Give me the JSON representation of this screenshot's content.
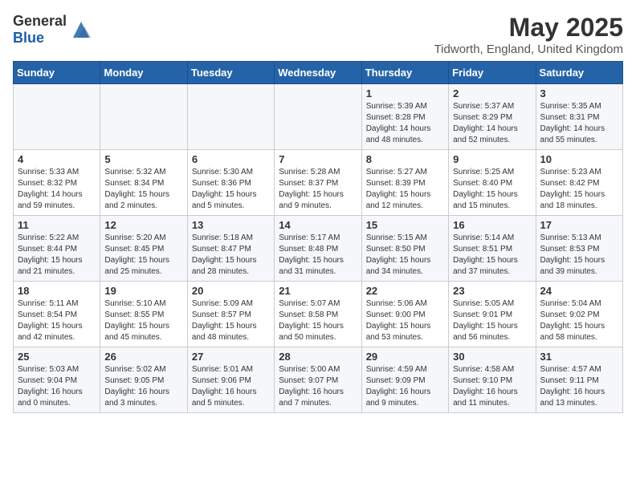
{
  "header": {
    "logo_general": "General",
    "logo_blue": "Blue",
    "month_year": "May 2025",
    "location": "Tidworth, England, United Kingdom"
  },
  "weekdays": [
    "Sunday",
    "Monday",
    "Tuesday",
    "Wednesday",
    "Thursday",
    "Friday",
    "Saturday"
  ],
  "weeks": [
    [
      {
        "day": "",
        "info": ""
      },
      {
        "day": "",
        "info": ""
      },
      {
        "day": "",
        "info": ""
      },
      {
        "day": "",
        "info": ""
      },
      {
        "day": "1",
        "info": "Sunrise: 5:39 AM\nSunset: 8:28 PM\nDaylight: 14 hours\nand 48 minutes."
      },
      {
        "day": "2",
        "info": "Sunrise: 5:37 AM\nSunset: 8:29 PM\nDaylight: 14 hours\nand 52 minutes."
      },
      {
        "day": "3",
        "info": "Sunrise: 5:35 AM\nSunset: 8:31 PM\nDaylight: 14 hours\nand 55 minutes."
      }
    ],
    [
      {
        "day": "4",
        "info": "Sunrise: 5:33 AM\nSunset: 8:32 PM\nDaylight: 14 hours\nand 59 minutes."
      },
      {
        "day": "5",
        "info": "Sunrise: 5:32 AM\nSunset: 8:34 PM\nDaylight: 15 hours\nand 2 minutes."
      },
      {
        "day": "6",
        "info": "Sunrise: 5:30 AM\nSunset: 8:36 PM\nDaylight: 15 hours\nand 5 minutes."
      },
      {
        "day": "7",
        "info": "Sunrise: 5:28 AM\nSunset: 8:37 PM\nDaylight: 15 hours\nand 9 minutes."
      },
      {
        "day": "8",
        "info": "Sunrise: 5:27 AM\nSunset: 8:39 PM\nDaylight: 15 hours\nand 12 minutes."
      },
      {
        "day": "9",
        "info": "Sunrise: 5:25 AM\nSunset: 8:40 PM\nDaylight: 15 hours\nand 15 minutes."
      },
      {
        "day": "10",
        "info": "Sunrise: 5:23 AM\nSunset: 8:42 PM\nDaylight: 15 hours\nand 18 minutes."
      }
    ],
    [
      {
        "day": "11",
        "info": "Sunrise: 5:22 AM\nSunset: 8:44 PM\nDaylight: 15 hours\nand 21 minutes."
      },
      {
        "day": "12",
        "info": "Sunrise: 5:20 AM\nSunset: 8:45 PM\nDaylight: 15 hours\nand 25 minutes."
      },
      {
        "day": "13",
        "info": "Sunrise: 5:18 AM\nSunset: 8:47 PM\nDaylight: 15 hours\nand 28 minutes."
      },
      {
        "day": "14",
        "info": "Sunrise: 5:17 AM\nSunset: 8:48 PM\nDaylight: 15 hours\nand 31 minutes."
      },
      {
        "day": "15",
        "info": "Sunrise: 5:15 AM\nSunset: 8:50 PM\nDaylight: 15 hours\nand 34 minutes."
      },
      {
        "day": "16",
        "info": "Sunrise: 5:14 AM\nSunset: 8:51 PM\nDaylight: 15 hours\nand 37 minutes."
      },
      {
        "day": "17",
        "info": "Sunrise: 5:13 AM\nSunset: 8:53 PM\nDaylight: 15 hours\nand 39 minutes."
      }
    ],
    [
      {
        "day": "18",
        "info": "Sunrise: 5:11 AM\nSunset: 8:54 PM\nDaylight: 15 hours\nand 42 minutes."
      },
      {
        "day": "19",
        "info": "Sunrise: 5:10 AM\nSunset: 8:55 PM\nDaylight: 15 hours\nand 45 minutes."
      },
      {
        "day": "20",
        "info": "Sunrise: 5:09 AM\nSunset: 8:57 PM\nDaylight: 15 hours\nand 48 minutes."
      },
      {
        "day": "21",
        "info": "Sunrise: 5:07 AM\nSunset: 8:58 PM\nDaylight: 15 hours\nand 50 minutes."
      },
      {
        "day": "22",
        "info": "Sunrise: 5:06 AM\nSunset: 9:00 PM\nDaylight: 15 hours\nand 53 minutes."
      },
      {
        "day": "23",
        "info": "Sunrise: 5:05 AM\nSunset: 9:01 PM\nDaylight: 15 hours\nand 56 minutes."
      },
      {
        "day": "24",
        "info": "Sunrise: 5:04 AM\nSunset: 9:02 PM\nDaylight: 15 hours\nand 58 minutes."
      }
    ],
    [
      {
        "day": "25",
        "info": "Sunrise: 5:03 AM\nSunset: 9:04 PM\nDaylight: 16 hours\nand 0 minutes."
      },
      {
        "day": "26",
        "info": "Sunrise: 5:02 AM\nSunset: 9:05 PM\nDaylight: 16 hours\nand 3 minutes."
      },
      {
        "day": "27",
        "info": "Sunrise: 5:01 AM\nSunset: 9:06 PM\nDaylight: 16 hours\nand 5 minutes."
      },
      {
        "day": "28",
        "info": "Sunrise: 5:00 AM\nSunset: 9:07 PM\nDaylight: 16 hours\nand 7 minutes."
      },
      {
        "day": "29",
        "info": "Sunrise: 4:59 AM\nSunset: 9:09 PM\nDaylight: 16 hours\nand 9 minutes."
      },
      {
        "day": "30",
        "info": "Sunrise: 4:58 AM\nSunset: 9:10 PM\nDaylight: 16 hours\nand 11 minutes."
      },
      {
        "day": "31",
        "info": "Sunrise: 4:57 AM\nSunset: 9:11 PM\nDaylight: 16 hours\nand 13 minutes."
      }
    ]
  ]
}
